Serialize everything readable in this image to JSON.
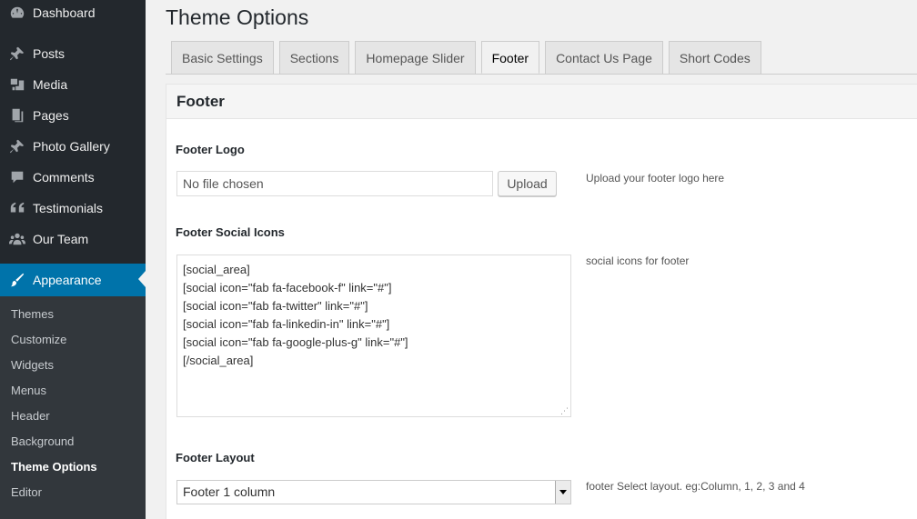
{
  "sidebar": {
    "menu": [
      {
        "label": "Dashboard",
        "icon": "dashboard-icon"
      },
      {
        "label": "Posts",
        "icon": "pin-icon"
      },
      {
        "label": "Media",
        "icon": "media-icon"
      },
      {
        "label": "Pages",
        "icon": "pages-icon"
      },
      {
        "label": "Photo Gallery",
        "icon": "pin-icon"
      },
      {
        "label": "Comments",
        "icon": "comment-icon"
      },
      {
        "label": "Testimonials",
        "icon": "quote-icon"
      },
      {
        "label": "Our Team",
        "icon": "team-icon"
      },
      {
        "label": "Appearance",
        "icon": "brush-icon"
      }
    ],
    "submenu": [
      "Themes",
      "Customize",
      "Widgets",
      "Menus",
      "Header",
      "Background",
      "Theme Options",
      "Editor"
    ],
    "current_submenu": "Theme Options",
    "colors": {
      "bg": "#23282d",
      "active": "#0073aa",
      "submenu_bg": "#32373c"
    }
  },
  "page": {
    "title": "Theme Options",
    "tabs": [
      "Basic Settings",
      "Sections",
      "Homepage Slider",
      "Footer",
      "Contact Us Page",
      "Short Codes"
    ],
    "active_tab": "Footer"
  },
  "panel": {
    "title": "Footer",
    "footer_logo": {
      "label": "Footer Logo",
      "file_text": "No file chosen",
      "button": "Upload",
      "description": "Upload your footer logo here"
    },
    "social_icons": {
      "label": "Footer Social Icons",
      "value": "[social_area]\n[social icon=\"fab fa-facebook-f\" link=\"#\"]\n[social icon=\"fab fa-twitter\" link=\"#\"]\n[social icon=\"fab fa-linkedin-in\" link=\"#\"]\n[social icon=\"fab fa-google-plus-g\" link=\"#\"]\n[/social_area]",
      "description": "social icons for footer"
    },
    "layout": {
      "label": "Footer Layout",
      "selected": "Footer 1 column",
      "description": "footer Select layout. eg:Column, 1, 2, 3 and 4"
    }
  }
}
